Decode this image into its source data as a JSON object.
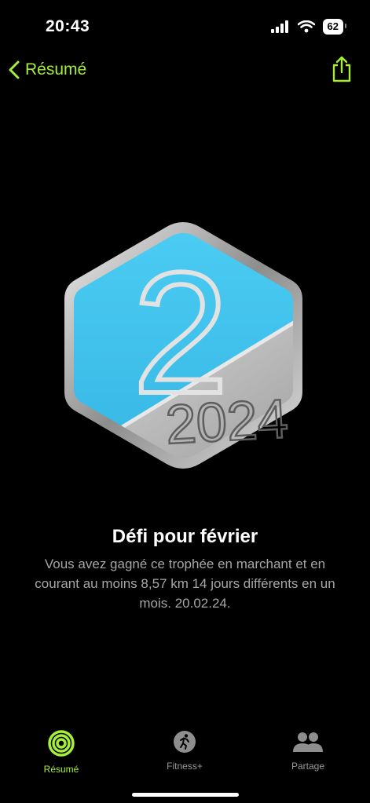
{
  "status": {
    "time": "20:43",
    "battery": "62"
  },
  "nav": {
    "back_label": "Résumé"
  },
  "badge": {
    "year_digit": "2",
    "year_text": "2024"
  },
  "award": {
    "title": "Défi pour février",
    "description": "Vous avez gagné ce trophée en marchant et en courant au moins 8,57 km 14 jours différents en un mois. 20.02.24."
  },
  "tabs": [
    {
      "label": "Résumé",
      "icon": "activity-rings-icon",
      "active": true
    },
    {
      "label": "Fitness+",
      "icon": "running-person-icon",
      "active": false
    },
    {
      "label": "Partage",
      "icon": "people-icon",
      "active": false
    }
  ],
  "colors": {
    "accent": "#a5ef38",
    "badge_blue": "#3ec0ea",
    "badge_silver": "#c9c9c9"
  }
}
